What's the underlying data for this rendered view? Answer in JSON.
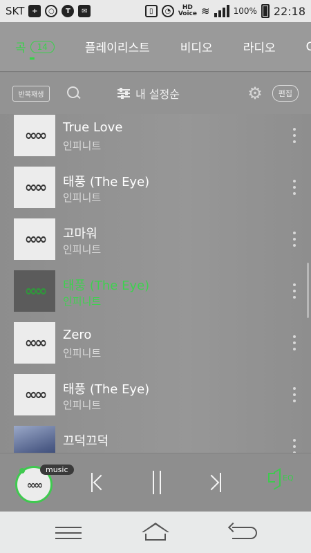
{
  "status_bar": {
    "carrier": "SKT",
    "hd_label": "HD",
    "voice_label": "Voice",
    "battery": "100%",
    "time": "22:18"
  },
  "tabs": {
    "songs": "곡",
    "songs_count": "14",
    "playlist": "플레이리스트",
    "video": "비디오",
    "radio": "라디오"
  },
  "toolbar": {
    "repeat_label": "반복재생",
    "sort_label": "내 설정순",
    "edit_label": "편집"
  },
  "songs": [
    {
      "title": "True Love",
      "artist": "인피니트",
      "playing": false
    },
    {
      "title": "태풍 (The Eye)",
      "artist": "인피니트",
      "playing": false
    },
    {
      "title": "고마워",
      "artist": "인피니트",
      "playing": false
    },
    {
      "title": "태풍 (The Eye)",
      "artist": "인피니트",
      "playing": true
    },
    {
      "title": "Zero",
      "artist": "인피니트",
      "playing": false
    },
    {
      "title": "태풍 (The Eye)",
      "artist": "인피니트",
      "playing": false
    },
    {
      "title": "끄덕끄덕",
      "artist": "",
      "playing": false
    }
  ],
  "player": {
    "app_tag": "music"
  },
  "colors": {
    "accent": "#3fc94f",
    "overlay": "#8f8f8f"
  }
}
